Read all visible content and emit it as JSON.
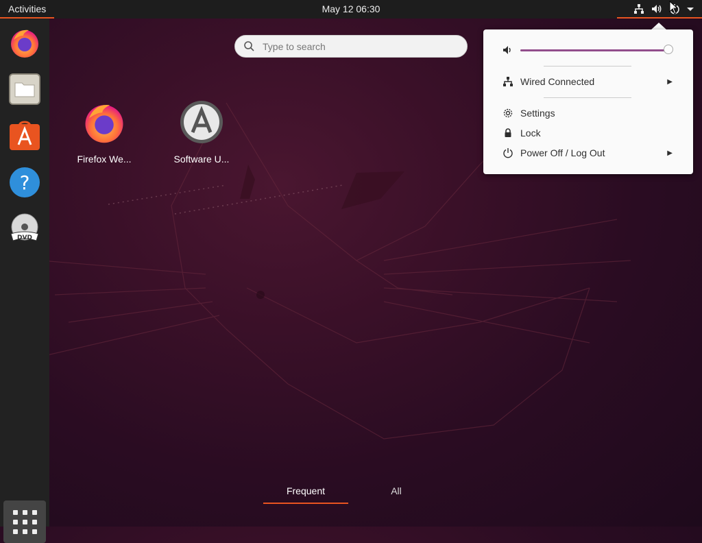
{
  "topbar": {
    "activities_label": "Activities",
    "clock": "May 12  06:30",
    "icons": [
      "network-wired-icon",
      "volume-icon",
      "power-icon",
      "dropdown-arrow-icon"
    ]
  },
  "dock": {
    "items": [
      {
        "name": "firefox",
        "icon": "firefox-icon"
      },
      {
        "name": "files",
        "icon": "files-icon"
      },
      {
        "name": "ubuntu-software",
        "icon": "software-center-icon"
      },
      {
        "name": "help",
        "icon": "help-icon"
      },
      {
        "name": "dvd",
        "icon": "dvd-icon"
      }
    ],
    "show_apps_icon": "app-grid-icon"
  },
  "search": {
    "placeholder": "Type to search"
  },
  "apps": [
    {
      "label": "Firefox We...",
      "icon": "firefox-icon"
    },
    {
      "label": "Software U...",
      "icon": "software-updater-icon"
    }
  ],
  "tabs": {
    "frequent": "Frequent",
    "all": "All"
  },
  "system_menu": {
    "volume": {
      "icon": "volume-icon",
      "level": 1.0
    },
    "network": {
      "label": "Wired Connected",
      "icon": "network-wired-icon"
    },
    "settings": {
      "label": "Settings",
      "icon": "gear-icon"
    },
    "lock": {
      "label": "Lock",
      "icon": "lock-icon"
    },
    "power": {
      "label": "Power Off / Log Out",
      "icon": "power-icon"
    }
  },
  "colors": {
    "accent": "#e95420",
    "slider": "#924d8b",
    "topbar": "#1d1d1d",
    "dock": "#222222"
  }
}
